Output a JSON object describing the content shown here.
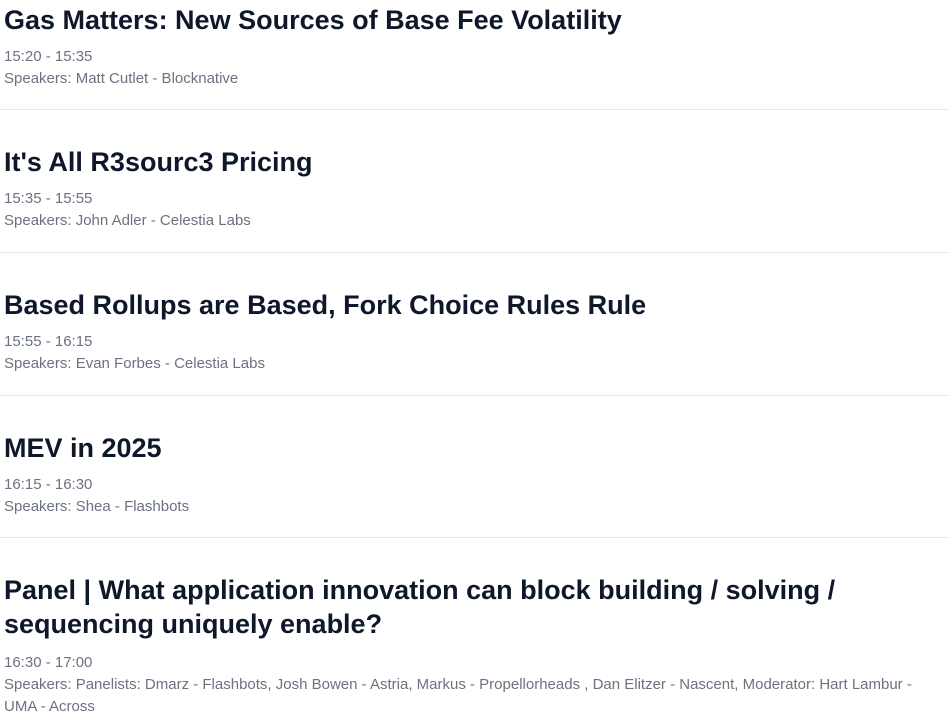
{
  "sessions": [
    {
      "title": "Gas Matters: New Sources of Base Fee Volatility",
      "time": "15:20 - 15:35",
      "speakers": "Speakers: Matt Cutlet - Blocknative"
    },
    {
      "title": "It's All R3sourc3 Pricing",
      "time": "15:35 - 15:55",
      "speakers": "Speakers: John Adler - Celestia Labs"
    },
    {
      "title": "Based Rollups are Based, Fork Choice Rules Rule",
      "time": "15:55 - 16:15",
      "speakers": "Speakers: Evan Forbes - Celestia Labs"
    },
    {
      "title": "MEV in 2025",
      "time": "16:15 - 16:30",
      "speakers": "Speakers: Shea - Flashbots"
    },
    {
      "title": "Panel | What application innovation can block building / solving / sequencing uniquely enable?",
      "time": "16:30 - 17:00",
      "speakers": "Speakers: Panelists: Dmarz - Flashbots, Josh Bowen - Astria, Markus - Propellorheads , Dan Elitzer - Nascent, Moderator: Hart Lambur - UMA - Across"
    }
  ]
}
